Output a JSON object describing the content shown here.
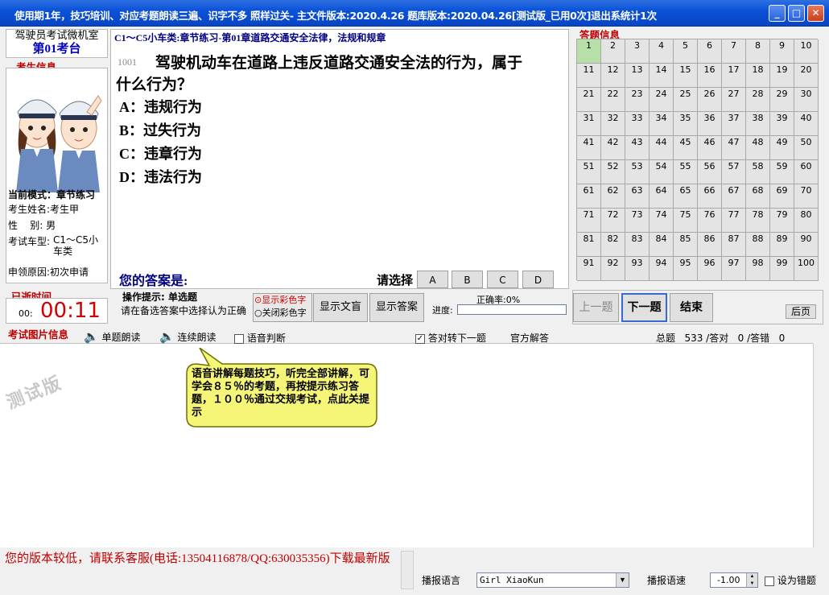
{
  "window": {
    "title": "使用期1年，技巧培训、对应考题朗读三遍、识字不多 照样过关- 主文件版本:2020.4.26 题库版本:2020.04.26[测试版_已用0次]退出系统计1次",
    "controls": {
      "minimize": "_",
      "maximize": "□",
      "close": "✕"
    }
  },
  "left": {
    "org_name": "驾驶员考试微机室",
    "station": "第01考台",
    "candidate_section": "考生信息",
    "mode": "当前模式：章节练习",
    "name": "考生姓名:考生甲",
    "gender": "性    别: 男",
    "car_type_label": "考试车型:",
    "car_type_value": "C1～C5小车类",
    "reason": "申领原因:初次申请",
    "elapsed_label": "已逝时间",
    "elapsed_hours": "00:",
    "elapsed_time": "00:11"
  },
  "question": {
    "chapter": "C1～C5小车类:章节练习-第01章道路交通安全法律，法规和规章",
    "number": "1001",
    "text_line1": "驾驶机动车在道路上违反道路交通安全法的行为，属于",
    "text_line2": "什么行为？",
    "options": [
      "A：违规行为",
      "B：过失行为",
      "C：违章行为",
      "D：违法行为"
    ],
    "your_answer": "您的答案是:",
    "select_label": "请选择",
    "choices": [
      "A",
      "B",
      "C",
      "D"
    ]
  },
  "operation": {
    "title": "操作提示: 单选题",
    "hint": "请在备选答案中选择认为正确",
    "color_on": "⊙显示彩色字",
    "color_off": "○关闭彩色字",
    "show_text": "显示文盲",
    "show_answer": "显示答案",
    "accuracy": "正确率:0%",
    "progress_label": "进度:",
    "progress": 0
  },
  "answer_info": {
    "title": "答题信息",
    "cells": [
      "1",
      "2",
      "3",
      "4",
      "5",
      "6",
      "7",
      "8",
      "9",
      "10",
      "11",
      "12",
      "13",
      "14",
      "15",
      "16",
      "17",
      "18",
      "19",
      "20",
      "21",
      "22",
      "23",
      "24",
      "25",
      "26",
      "27",
      "28",
      "29",
      "30",
      "31",
      "32",
      "33",
      "34",
      "35",
      "36",
      "37",
      "38",
      "39",
      "40",
      "41",
      "42",
      "43",
      "44",
      "45",
      "46",
      "47",
      "48",
      "49",
      "50",
      "51",
      "52",
      "53",
      "54",
      "55",
      "56",
      "57",
      "58",
      "59",
      "60",
      "61",
      "62",
      "63",
      "64",
      "65",
      "66",
      "67",
      "68",
      "69",
      "70",
      "71",
      "72",
      "73",
      "74",
      "75",
      "76",
      "77",
      "78",
      "79",
      "80",
      "81",
      "82",
      "83",
      "84",
      "85",
      "86",
      "87",
      "88",
      "89",
      "90",
      "91",
      "92",
      "93",
      "94",
      "95",
      "96",
      "97",
      "98",
      "99",
      "100"
    ],
    "active_cell": "1"
  },
  "nav": {
    "prev": "上一题",
    "next": "下一题",
    "end": "结束",
    "back": "后页"
  },
  "image_info": {
    "title": "考试图片信息",
    "read_single": "单题朗读",
    "read_continuous": "连续朗读",
    "voice_judge": "语音判断",
    "auto_next": "答对转下一题",
    "official": "官方解答",
    "stats": "总题   533 /答对   0 /答错   0",
    "watermark": "测试版",
    "bubble": "语音讲解每题技巧，听完全部讲解，可学会８５％的考题，再按提示练习答题，１００％通过交规考试，点此关提示"
  },
  "footer": {
    "notice": "您的版本较低，请联系客服(电话:13504116878/QQ:630035356)下载最新版",
    "voice_label": "播报语言",
    "voice_value": "Girl XiaoKun",
    "speed_label": "播报语速",
    "speed_value": "-1.00",
    "wrong_label": "设为错题"
  }
}
